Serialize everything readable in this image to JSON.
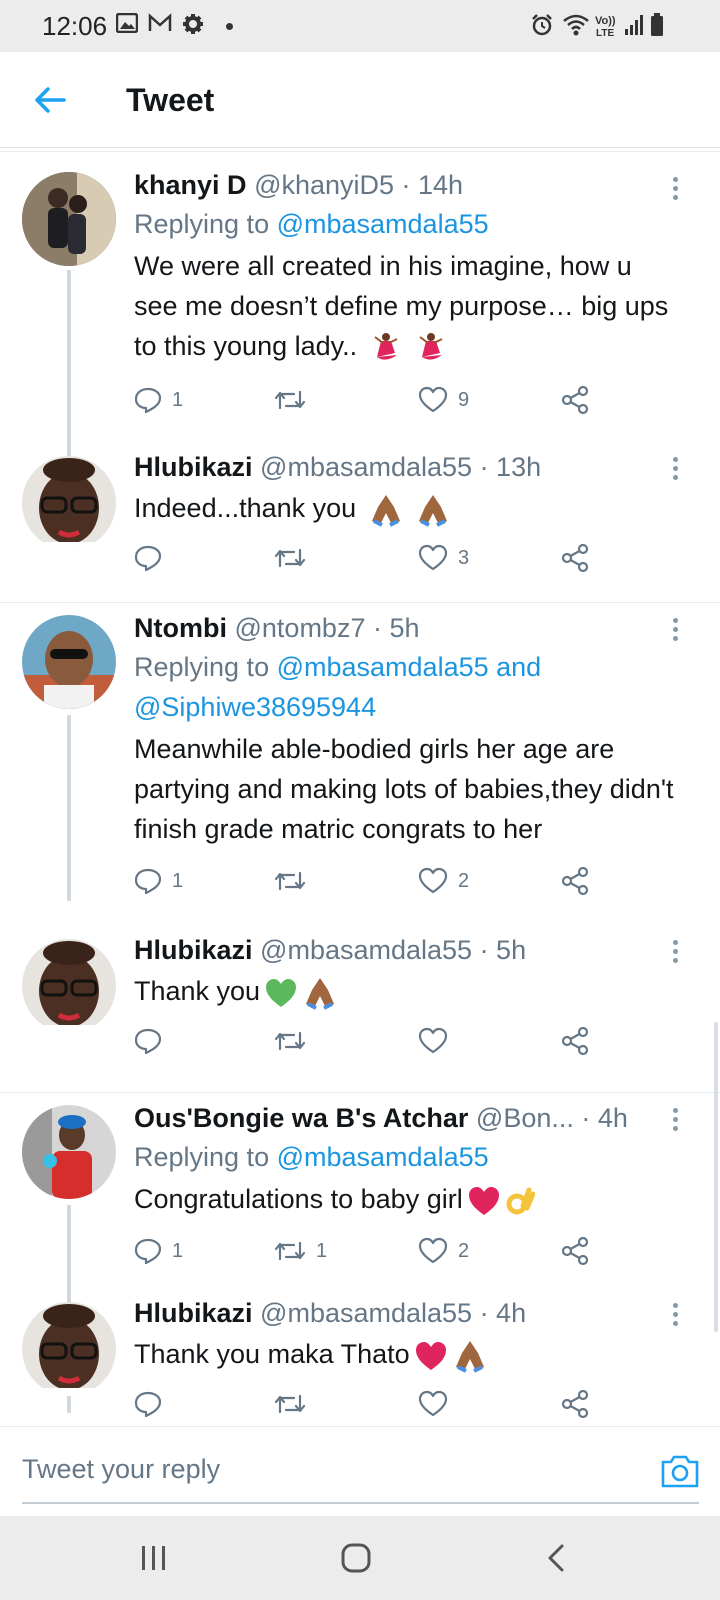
{
  "status_bar": {
    "time": "12:06",
    "left_icons": [
      "image-icon",
      "mail-icon",
      "gear-icon"
    ],
    "right_icons": [
      "alarm-icon",
      "wifi-icon",
      "volte-icon",
      "signal-icon",
      "battery-icon"
    ],
    "volte_label": "Vo)) LTE"
  },
  "header": {
    "title": "Tweet",
    "back_icon": "arrow-left-icon",
    "accent": "#1da1f2"
  },
  "tweets": [
    {
      "name": "khanyi D",
      "handle": "@khanyiD5 · 14h",
      "replying_label": "Replying to ",
      "replying_to": "@mbasamdala55",
      "text": "We were all created in his imagine, how u see me doesn’t define my purpose… big ups to this young lady..",
      "emoji": [
        "dancer-emoji",
        "dancer-emoji"
      ],
      "replies": "1",
      "retweets": "",
      "likes": "9"
    },
    {
      "name": "Hlubikazi",
      "handle": "@mbasamdala55 · 13h",
      "text": "Indeed...thank you",
      "emoji": [
        "folded-hands-emoji",
        "folded-hands-emoji"
      ],
      "replies": "",
      "retweets": "",
      "likes": "3"
    },
    {
      "name": "Ntombi",
      "handle": "@ntombz7 · 5h",
      "replying_label": "Replying to ",
      "replying_to": "@mbasamdala55 and",
      "replying_to_2": "@Siphiwe38695944",
      "text": "Meanwhile able-bodied girls her age are partying and making lots of babies,they didn't finish grade matric congrats to her",
      "replies": "1",
      "retweets": "",
      "likes": "2"
    },
    {
      "name": "Hlubikazi",
      "handle": "@mbasamdala55 · 5h",
      "text": "Thank you",
      "emoji": [
        "green-heart-emoji",
        "folded-hands-emoji"
      ],
      "replies": "",
      "retweets": "",
      "likes": ""
    },
    {
      "name": "Ous'Bongie wa B's Atchar",
      "handle": "@Bon...",
      "time": " · 4h",
      "replying_label": "Replying to ",
      "replying_to": "@mbasamdala55",
      "text": "Congratulations to baby girl",
      "emoji": [
        "red-heart-emoji",
        "ok-hand-emoji"
      ],
      "replies": "1",
      "retweets": "1",
      "likes": "2"
    },
    {
      "name": "Hlubikazi",
      "handle": "@mbasamdala55 · 4h",
      "text": "Thank you maka Thato",
      "emoji": [
        "red-heart-emoji",
        "folded-hands-emoji"
      ],
      "replies": "",
      "retweets": "",
      "likes": ""
    }
  ],
  "reply_bar": {
    "placeholder": "Tweet your reply",
    "camera_icon": "camera-icon"
  },
  "nav_bar": {
    "icons": [
      "recent-apps-icon",
      "home-icon",
      "back-icon"
    ]
  }
}
